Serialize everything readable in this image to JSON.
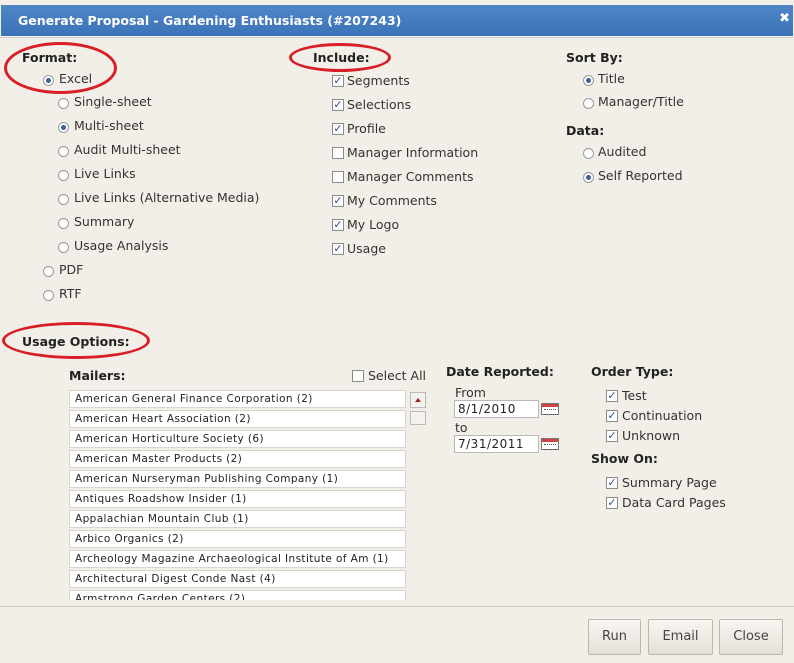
{
  "dialog": {
    "title": "Generate Proposal - Gardening Enthusiasts (#207243)",
    "close_glyph": "✖"
  },
  "format": {
    "heading": "Format:",
    "excel": "Excel",
    "excel_options": [
      "Single-sheet",
      "Multi-sheet",
      "Audit Multi-sheet",
      "Live Links",
      "Live Links (Alternative Media)",
      "Summary",
      "Usage Analysis"
    ],
    "pdf": "PDF",
    "rtf": "RTF"
  },
  "include": {
    "heading": "Include:",
    "items": [
      "Segments",
      "Selections",
      "Profile",
      "Manager Information",
      "Manager Comments",
      "My Comments",
      "My Logo",
      "Usage"
    ]
  },
  "sort": {
    "heading": "Sort By:",
    "options": [
      "Title",
      "Manager/Title"
    ]
  },
  "data_section": {
    "heading": "Data:",
    "options": [
      "Audited",
      "Self Reported"
    ]
  },
  "usage": {
    "heading": "Usage Options:"
  },
  "mailers": {
    "heading": "Mailers:",
    "select_all": "Select All",
    "items": [
      "American General Finance Corporation (2)",
      "American Heart Association (2)",
      "American Horticulture Society (6)",
      "American Master Products (2)",
      "American Nurseryman Publishing Company (1)",
      "Antiques Roadshow Insider (1)",
      "Appalachian Mountain Club (1)",
      "Arbico Organics (2)",
      "Archeology Magazine Archaeological Institute of Am (1)",
      "Architectural Digest Conde Nast (4)",
      "Armstrong Garden Centers (2)"
    ]
  },
  "date_reported": {
    "heading": "Date Reported:",
    "from_label": "From",
    "from_value": "8/1/2010",
    "to_label": "to",
    "to_value": "7/31/2011"
  },
  "order_type": {
    "heading": "Order Type:",
    "items": [
      "Test",
      "Continuation",
      "Unknown"
    ]
  },
  "show_on": {
    "heading": "Show On:",
    "items": [
      "Summary Page",
      "Data Card Pages"
    ]
  },
  "buttons": {
    "run": "Run",
    "email": "Email",
    "close": "Close"
  },
  "colors": {
    "titlebar": "#3b73b8",
    "annotation": "#d81f27"
  }
}
